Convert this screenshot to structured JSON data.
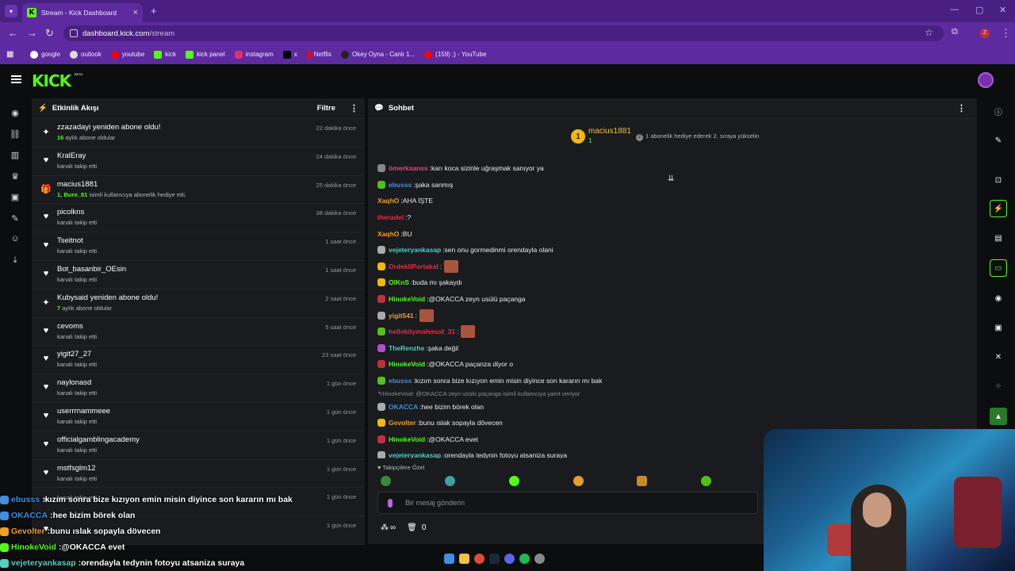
{
  "browser": {
    "tab_title": "Stream - Kick Dashboard",
    "url_domain": "dashboard.kick.com",
    "url_path": "/stream",
    "bookmarks": [
      {
        "label": "google",
        "color": "#ffffff"
      },
      {
        "label": "outlook",
        "color": "#ffffff"
      },
      {
        "label": "youtube",
        "color": "#ff0000"
      },
      {
        "label": "kick",
        "color": "#53fc18"
      },
      {
        "label": "kick panel",
        "color": "#53fc18"
      },
      {
        "label": "instagram",
        "color": "#e1306c"
      },
      {
        "label": "x",
        "color": "#000000"
      },
      {
        "label": "Netflix",
        "color": "#e50914"
      },
      {
        "label": "Okey Oyna - Canlı 1...",
        "color": "#222222"
      },
      {
        "label": "(159) ;) - YouTube",
        "color": "#ff0000"
      }
    ]
  },
  "kick": {
    "logo": "KICK",
    "beta": "BETA",
    "accent": "#53fc18"
  },
  "activity": {
    "title": "Etkinlik Akışı",
    "filter": "Filtre",
    "events": [
      {
        "icon": "sparkle-icon",
        "user": "zzazadayi yeniden abone oldu!",
        "sub_bold": "16",
        "sub": " aylık abone oldular",
        "time": "22 dakika önce"
      },
      {
        "icon": "heart-icon",
        "user": "KralEray",
        "sub_bold": "",
        "sub": "kanalı takip etti",
        "time": "24 dakika önce"
      },
      {
        "icon": "gift-icon",
        "user": "macius1881",
        "sub_bold": "1, Buro_81",
        "sub": " isimli kullanıcıya abonelik hediye etti.",
        "time": "25 dakika önce"
      },
      {
        "icon": "heart-icon",
        "user": "picolkns",
        "sub_bold": "",
        "sub": "kanalı takip etti",
        "time": "38 dakika önce"
      },
      {
        "icon": "heart-icon",
        "user": "Tseitnot",
        "sub_bold": "",
        "sub": "kanalı takip etti",
        "time": "1 saat önce"
      },
      {
        "icon": "heart-icon",
        "user": "Bot_basanbir_OEsin",
        "sub_bold": "",
        "sub": "kanalı takip etti",
        "time": "1 saat önce"
      },
      {
        "icon": "sparkle-icon",
        "user": "Kubysaid yeniden abone oldu!",
        "sub_bold": "7",
        "sub": " aylık abone oldular",
        "time": "2 saat önce"
      },
      {
        "icon": "heart-icon",
        "user": "cevoms",
        "sub_bold": "",
        "sub": "kanalı takip etti",
        "time": "5 saat önce"
      },
      {
        "icon": "heart-icon",
        "user": "yigit27_27",
        "sub_bold": "",
        "sub": "kanalı takip etti",
        "time": "23 saat önce"
      },
      {
        "icon": "heart-icon",
        "user": "naylonasd",
        "sub_bold": "",
        "sub": "kanalı takip etti",
        "time": "1 gün önce"
      },
      {
        "icon": "heart-icon",
        "user": "userrrnammeee",
        "sub_bold": "",
        "sub": "kanalı takip etti",
        "time": "1 gün önce"
      },
      {
        "icon": "heart-icon",
        "user": "officialgamblingacademy",
        "sub_bold": "",
        "sub": "kanalı takip etti",
        "time": "1 gün önce"
      },
      {
        "icon": "heart-icon",
        "user": "mstfsglm12",
        "sub_bold": "",
        "sub": "kanalı takip etti",
        "time": "1 gün önce"
      },
      {
        "icon": "heart-icon",
        "user": "",
        "sub_bold": "",
        "sub": "kanalı takip etti",
        "time": "1 gün önce"
      },
      {
        "icon": "heart-icon",
        "user": "",
        "sub_bold": "",
        "sub": "",
        "time": "1 gün önce"
      }
    ]
  },
  "chat": {
    "title": "Sohbet",
    "top_gifter": "macius1881",
    "top_gifter_count": "1",
    "gift_hint_num": "2",
    "gift_hint": "1 abonelik hediye ederek 2. sıraya yükselin",
    "messages": [
      {
        "user": "ömerkaanss",
        "color": "#e0457b",
        "badge": "#888888",
        "text": "karı koca sizinle uğraşmak sanıyor ya"
      },
      {
        "user": "ebusss",
        "color": "#3f8fe0",
        "badge": "#53c018",
        "text": "şaka sanmış"
      },
      {
        "user": "XaqhO",
        "color": "#f0a020",
        "badge": "",
        "text": "AHA İŞTE"
      },
      {
        "user": "theradel",
        "color": "#e0304a",
        "badge": "",
        "text": "?"
      },
      {
        "user": "XaqhO",
        "color": "#f0a020",
        "badge": "",
        "text": "BU"
      },
      {
        "user": "vejeteryankasap",
        "color": "#53d0c0",
        "badge": "#aaaaaa",
        "text": "sen onu gormedinmi orendayla olani"
      },
      {
        "user": "OrdekliPortakal",
        "color": "#e0304a",
        "badge": "#f0b90b",
        "text": "",
        "emote": true
      },
      {
        "user": "OlKnS",
        "color": "#53fc18",
        "badge": "#f0b90b",
        "text": "buda mı şakaydı"
      },
      {
        "user": "HinokeVoid",
        "color": "#53fc18",
        "badge": "#c0303a",
        "text": "@OKACCA zeyn usülü paçanga"
      },
      {
        "user": "yigit541",
        "color": "#f0a020",
        "badge": "#aaaaaa",
        "text": "",
        "emote": true
      },
      {
        "user": "hellokitymahmud_31",
        "color": "#e0304a",
        "badge": "#53c018",
        "text": "",
        "emote": true
      },
      {
        "user": "TheRenzhe",
        "color": "#53d0c0",
        "badge": "#b050d0",
        "text": "şaka değil"
      },
      {
        "user": "HinokeVoid",
        "color": "#53fc18",
        "badge": "#c0303a",
        "text": "@OKACCA paçanza diyor o"
      },
      {
        "user": "ebusss",
        "color": "#3f8fe0",
        "badge": "#53c018",
        "text": "kızım sonra bize kızıyon emin misin diyince son kararın mı bak"
      }
    ],
    "reply_note": "HinokeVoid: @OKACCA zeyn usülü paçanga isimli kullanıcıya yanıt veriyor",
    "messages2": [
      {
        "user": "OKACCA",
        "color": "#3f8fe0",
        "badge": "#aaaaaa",
        "text": "hee bizim börek olan"
      },
      {
        "user": "Gevolter",
        "color": "#f0a020",
        "badge": "#f0b90b",
        "text": "bunu ıslak sopayla dövecen"
      },
      {
        "user": "HinokeVoid",
        "color": "#53fc18",
        "badge": "#c0303a",
        "text": "@OKACCA evet"
      },
      {
        "user": "vejeteryankasap",
        "color": "#53d0c0",
        "badge": "#aaaaaa",
        "text": "orendayla tedynin fotoyu atsaniza suraya"
      }
    ],
    "followers_only": "Takipçilere Özel",
    "placeholder": "Bir mesaj gönderin",
    "infinity": "∞",
    "zero": "0"
  },
  "overlay": [
    {
      "user": "ebusss",
      "color": "#3f8fe0",
      "text": "kızım sonra bize kızıyon emin misin diyince son kararın mı bak"
    },
    {
      "user": "OKACCA",
      "color": "#3f8fe0",
      "text": "hee bizim börek olan"
    },
    {
      "user": "Gevolter",
      "color": "#f0a020",
      "text": "bunu ıslak sopayla dövecen"
    },
    {
      "user": "HinokeVoid",
      "color": "#53fc18",
      "text": "@OKACCA evet"
    },
    {
      "user": "vejeteryankasap",
      "color": "#53d0c0",
      "text": "orendayla tedynin fotoyu atsaniza suraya"
    }
  ]
}
